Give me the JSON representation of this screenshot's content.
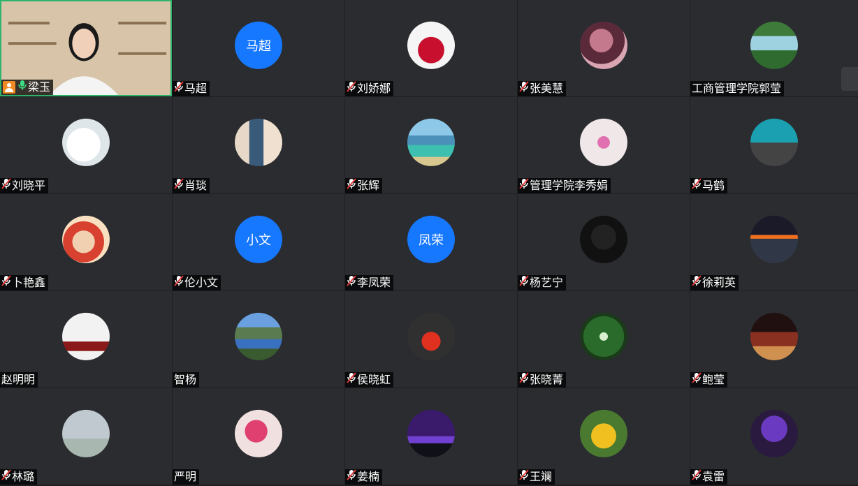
{
  "colors": {
    "accent_blue": "#1677ff",
    "active_border": "#2db36b",
    "tile_bg": "#2a2c30",
    "muted_red": "#e23b3b"
  },
  "participants": [
    {
      "name": "梁玉",
      "video": true,
      "mic": "on",
      "host": true
    },
    {
      "name": "马超",
      "avatar_text": "马超",
      "avatar_color": "#1677ff",
      "mic": "muted"
    },
    {
      "name": "刘娇娜",
      "avatar_style": "red-dress",
      "mic": "muted"
    },
    {
      "name": "张美慧",
      "avatar_style": "anime",
      "mic": "muted"
    },
    {
      "name": "工商管理学院郭莹",
      "avatar_style": "waterfall",
      "mic": "none"
    },
    {
      "name": "刘晓平",
      "avatar_style": "book",
      "mic": "muted"
    },
    {
      "name": "肖琰",
      "avatar_style": "kids",
      "mic": "muted"
    },
    {
      "name": "张辉",
      "avatar_style": "sea-bridge",
      "mic": "muted"
    },
    {
      "name": "管理学院李秀娟",
      "avatar_style": "drawing",
      "mic": "muted"
    },
    {
      "name": "马鹤",
      "avatar_style": "dolphin",
      "mic": "muted"
    },
    {
      "name": "卜艳鑫",
      "avatar_style": "baby",
      "mic": "muted"
    },
    {
      "name": "伦小文",
      "avatar_text": "小文",
      "avatar_color": "#1677ff",
      "mic": "muted"
    },
    {
      "name": "李凤荣",
      "avatar_text": "凤荣",
      "avatar_color": "#1677ff",
      "mic": "muted"
    },
    {
      "name": "杨艺宁",
      "avatar_style": "silhouette",
      "mic": "muted"
    },
    {
      "name": "徐莉英",
      "avatar_style": "sunset",
      "mic": "muted"
    },
    {
      "name": "赵明明",
      "avatar_style": "room",
      "mic": "none"
    },
    {
      "name": "智杨",
      "avatar_style": "lake",
      "mic": "none"
    },
    {
      "name": "侯晓虹",
      "avatar_style": "sculpture",
      "mic": "muted"
    },
    {
      "name": "张晓菁",
      "avatar_style": "trees",
      "mic": "muted"
    },
    {
      "name": "鲍莹",
      "avatar_style": "temple",
      "mic": "muted"
    },
    {
      "name": "林璐",
      "avatar_style": "statue",
      "mic": "muted"
    },
    {
      "name": "严明",
      "avatar_style": "flowers",
      "mic": "none"
    },
    {
      "name": "姜楠",
      "avatar_style": "moon",
      "mic": "muted"
    },
    {
      "name": "王斓",
      "avatar_style": "child-yellow",
      "mic": "muted"
    },
    {
      "name": "袁雷",
      "avatar_style": "purple-dark",
      "mic": "muted"
    }
  ]
}
